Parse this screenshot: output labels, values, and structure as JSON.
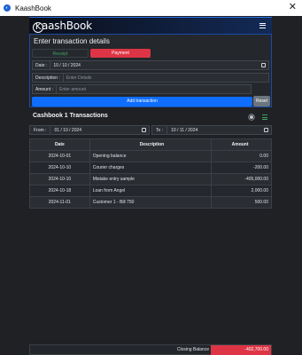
{
  "window": {
    "title": "KaashBook",
    "icon": "kaashbook-app-icon",
    "close_glyph": "✕"
  },
  "navbar": {
    "brand_k": "K",
    "brand_rest": "aashBook",
    "menu_icon": "hamburger-icon"
  },
  "form": {
    "title": "Enter transaction details",
    "tabs": {
      "receipt": "Receipt",
      "payment": "Payment",
      "active": "Payment"
    },
    "date_label": "Date :",
    "date_value": "10 / 10 / 2024",
    "description_label": "Description :",
    "description_placeholder": "Enter Details",
    "amount_label": "Amount :",
    "amount_placeholder": "Enter amount",
    "add_button": "Add transaction",
    "reset_button": "Reset"
  },
  "cashbook": {
    "title": "Cashbook 1 Transactions",
    "from_label": "From :",
    "from_value": "01 / 10 / 2024",
    "to_label": "To :",
    "to_value": "10 / 11 / 2024"
  },
  "table": {
    "headers": {
      "date": "Date",
      "description": "Description",
      "amount": "Amount"
    },
    "rows": [
      {
        "date": "2024-10-01",
        "description": "Opening balance",
        "amount": "0.00"
      },
      {
        "date": "2024-10-10",
        "description": "Courier charges",
        "amount": "-200.00"
      },
      {
        "date": "2024-10-10",
        "description": "Mistake entry sample",
        "amount": "-405,000.00"
      },
      {
        "date": "2024-10-18",
        "description": "Loan from Angel",
        "amount": "2,000.00"
      },
      {
        "date": "2024-11-01",
        "description": "Customer 1 - Bill 750",
        "amount": "500.00"
      }
    ]
  },
  "footer": {
    "closing_label": "Closing Balance",
    "closing_amount": "-402,700.00"
  },
  "colors": {
    "accent": "#0f6efd",
    "danger": "#dd3545",
    "success": "#3fa462",
    "secondary": "#6c757d"
  }
}
